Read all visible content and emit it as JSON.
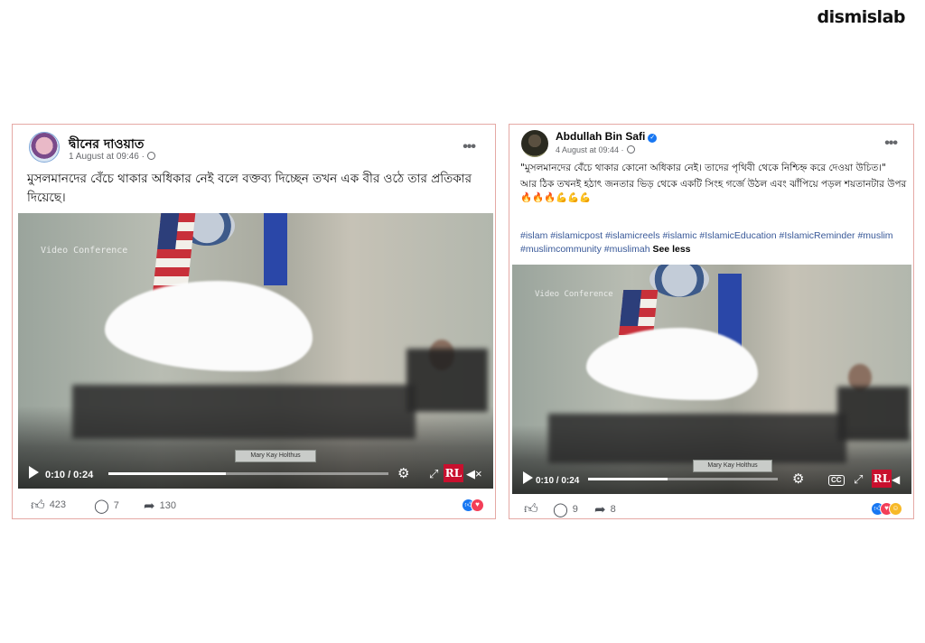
{
  "brand": {
    "logo_text": "dismislab"
  },
  "posts": [
    {
      "author": "দ্বীনের দাওয়াত",
      "timestamp": "1 August at 09:46 ·",
      "caption": "মুসলমানদের বেঁচে থাকার অধিকার নেই বলে বক্তব্য দিচ্ছেন তখন এক বীর ওঠে তার প্রতিকার দিয়েছে।",
      "video": {
        "watermark": "Video Conference",
        "time": "0:10 / 0:24",
        "progress": 0.42,
        "nameplate": "Mary Kay Holthus"
      },
      "actions": {
        "likes": "423",
        "comments": "7",
        "shares": "130"
      },
      "reactions": [
        "like",
        "love"
      ]
    },
    {
      "author": "Abdullah Bin Safi",
      "timestamp": "4 August at 09:44 ·",
      "caption_lines": [
        "\"মুসলমানদের বেঁচে থাকার কোনো অধিকার নেই। তাদের পৃথিবী থেকে নিশ্চিহ্ন করে দেওয়া উচিত।\"",
        "আর ঠিক তখনই হঠাৎ জনতার ভিড় থেকে একটি সিংহ গর্জে উঠল এবং ঝাঁপিয়ে পড়ল শয়তানটার উপর🔥🔥🔥💪💪💪"
      ],
      "hashtags": "#islam #islamicpost #islamicreels #islamic #IslamicEducation #IslamicReminder #muslim #muslimcommunity #muslimah",
      "see_less": "See less",
      "video": {
        "watermark": "Video Conference",
        "time": "0:10 / 0:24",
        "progress": 0.42,
        "nameplate": "Mary Kay Holthus"
      },
      "actions": {
        "likes": "",
        "comments": "9",
        "shares": "8"
      },
      "reactions": [
        "like",
        "love",
        "haha"
      ]
    }
  ],
  "icons": {
    "like": "thumbs-up-icon",
    "comment": "comment-bubble-icon",
    "share": "share-arrow-icon",
    "settings": "gear-icon",
    "fullscreen": "fullscreen-icon",
    "volume": "speaker-icon",
    "play": "play-icon",
    "more": "more-dots-icon",
    "privacy": "globe-icon",
    "verified": "verified-badge-icon"
  },
  "colors": {
    "accent": "#1877f2",
    "border": "#e5a9a5",
    "hashtag": "#385898",
    "rl_badge": "#c8103e"
  }
}
